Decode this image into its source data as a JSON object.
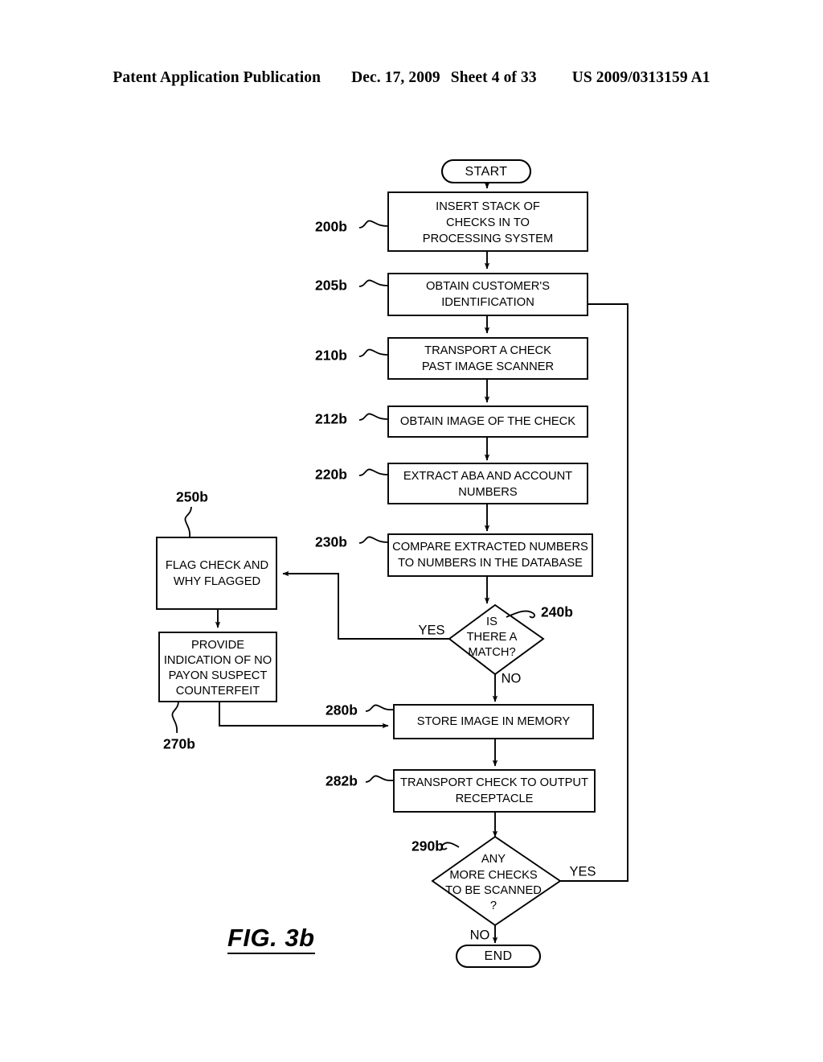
{
  "header": {
    "publication": "Patent Application Publication",
    "date": "Dec. 17, 2009",
    "sheet": "Sheet 4 of 33",
    "number": "US 2009/0313159 A1"
  },
  "figure": {
    "caption": "FIG. 3b"
  },
  "chart_data": {
    "type": "diagram",
    "title": "FIG. 3b",
    "nodes": [
      {
        "id": "start",
        "ref": "",
        "shape": "terminator",
        "label": "START"
      },
      {
        "id": "n200b",
        "ref": "200b",
        "shape": "process",
        "label": "INSERT STACK OF CHECKS IN TO PROCESSING SYSTEM"
      },
      {
        "id": "n205b",
        "ref": "205b",
        "shape": "process",
        "label": "OBTAIN CUSTOMER'S IDENTIFICATION"
      },
      {
        "id": "n210b",
        "ref": "210b",
        "shape": "process",
        "label": "TRANSPORT A CHECK PAST IMAGE SCANNER"
      },
      {
        "id": "n212b",
        "ref": "212b",
        "shape": "process",
        "label": "OBTAIN IMAGE OF THE CHECK"
      },
      {
        "id": "n220b",
        "ref": "220b",
        "shape": "process",
        "label": "EXTRACT ABA AND ACCOUNT NUMBERS"
      },
      {
        "id": "n230b",
        "ref": "230b",
        "shape": "process",
        "label": "COMPARE EXTRACTED NUMBERS TO NUMBERS IN THE DATABASE"
      },
      {
        "id": "n240b",
        "ref": "240b",
        "shape": "decision",
        "label": "IS THERE A MATCH?"
      },
      {
        "id": "n250b",
        "ref": "250b",
        "shape": "process",
        "label": "FLAG CHECK AND WHY FLAGGED"
      },
      {
        "id": "n270b",
        "ref": "270b",
        "shape": "process",
        "label": "PROVIDE INDICATION OF NO PAYON SUSPECT COUNTERFEIT"
      },
      {
        "id": "n280b",
        "ref": "280b",
        "shape": "process",
        "label": "STORE IMAGE IN MEMORY"
      },
      {
        "id": "n282b",
        "ref": "282b",
        "shape": "process",
        "label": "TRANSPORT CHECK TO OUTPUT RECEPTACLE"
      },
      {
        "id": "n290b",
        "ref": "290b",
        "shape": "decision",
        "label": "ANY MORE CHECKS TO BE SCANNED ?"
      },
      {
        "id": "end",
        "ref": "",
        "shape": "terminator",
        "label": "END"
      }
    ],
    "edges": [
      {
        "from": "start",
        "to": "n200b",
        "label": ""
      },
      {
        "from": "n200b",
        "to": "n205b",
        "label": ""
      },
      {
        "from": "n205b",
        "to": "n210b",
        "label": ""
      },
      {
        "from": "n210b",
        "to": "n212b",
        "label": ""
      },
      {
        "from": "n212b",
        "to": "n220b",
        "label": ""
      },
      {
        "from": "n220b",
        "to": "n230b",
        "label": ""
      },
      {
        "from": "n230b",
        "to": "n240b",
        "label": ""
      },
      {
        "from": "n240b",
        "to": "n250b",
        "label": "YES"
      },
      {
        "from": "n240b",
        "to": "n280b",
        "label": "NO"
      },
      {
        "from": "n250b",
        "to": "n270b",
        "label": ""
      },
      {
        "from": "n270b",
        "to": "n280b",
        "label": ""
      },
      {
        "from": "n280b",
        "to": "n282b",
        "label": ""
      },
      {
        "from": "n282b",
        "to": "n290b",
        "label": ""
      },
      {
        "from": "n290b",
        "to": "n205b",
        "label": "YES"
      },
      {
        "from": "n290b",
        "to": "end",
        "label": "NO"
      }
    ]
  },
  "nodes": {
    "start": {
      "label": "START"
    },
    "end": {
      "label": "END"
    },
    "n200b": {
      "ref": "200b",
      "line1": "INSERT STACK OF",
      "line2": "CHECKS IN TO",
      "line3": "PROCESSING SYSTEM"
    },
    "n205b": {
      "ref": "205b",
      "line1": "OBTAIN CUSTOMER'S",
      "line2": "IDENTIFICATION"
    },
    "n210b": {
      "ref": "210b",
      "line1": "TRANSPORT A CHECK",
      "line2": "PAST IMAGE SCANNER"
    },
    "n212b": {
      "ref": "212b",
      "line1": "OBTAIN IMAGE OF THE CHECK"
    },
    "n220b": {
      "ref": "220b",
      "line1": "EXTRACT ABA AND ACCOUNT",
      "line2": "NUMBERS"
    },
    "n230b": {
      "ref": "230b",
      "line1": "COMPARE EXTRACTED NUMBERS",
      "line2": "TO NUMBERS IN THE DATABASE"
    },
    "n240b": {
      "ref": "240b",
      "line1": "IS",
      "line2": "THERE A",
      "line3": "MATCH?"
    },
    "n250b": {
      "ref": "250b",
      "line1": "FLAG CHECK AND",
      "line2": "WHY FLAGGED"
    },
    "n270b": {
      "ref": "270b",
      "line1": "PROVIDE",
      "line2": "INDICATION OF NO",
      "line3": "PAYON SUSPECT",
      "line4": "COUNTERFEIT"
    },
    "n280b": {
      "ref": "280b",
      "line1": "STORE IMAGE IN MEMORY"
    },
    "n282b": {
      "ref": "282b",
      "line1": "TRANSPORT CHECK TO OUTPUT",
      "line2": "RECEPTACLE"
    },
    "n290b": {
      "ref": "290b",
      "line1": "ANY",
      "line2": "MORE CHECKS",
      "line3": "TO BE SCANNED",
      "line4": "?"
    }
  },
  "branches": {
    "match_yes": "YES",
    "match_no": "NO",
    "more_yes": "YES",
    "more_no": "NO"
  }
}
